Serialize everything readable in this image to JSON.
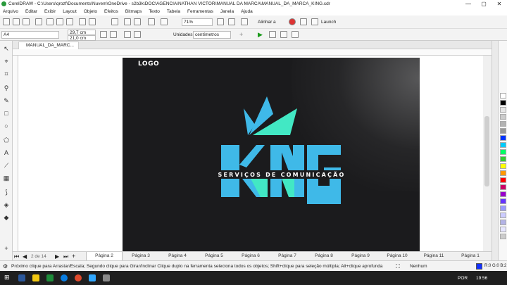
{
  "window": {
    "title": "CorelDRAW - C:\\Users\\qrozf\\Documents\\Nuvem\\OneDrive - s2b3k\\DOC\\AGENCIA\\NATHAN VICTOR\\MANUAL DA MARCA\\MANUAL_DA_MARCA_KING.cdr",
    "minimize": "—",
    "maximize": "▢",
    "close": "✕"
  },
  "menu": [
    "Arquivo",
    "Editar",
    "Exibir",
    "Layout",
    "Objeto",
    "Efeitos",
    "Bitmaps",
    "Texto",
    "Tabela",
    "Ferramentas",
    "Janela",
    "Ajuda"
  ],
  "toolbar1": {
    "zoom": "71%",
    "align_label": "Alinhar a",
    "launch_label": "Launch"
  },
  "toolbar2": {
    "page_size": "A4",
    "width": "29,7 cm",
    "height": "21,0 cm",
    "units_label": "Unidades:",
    "units_value": "centímetros"
  },
  "document": {
    "tab_label": "MANUAL_DA_MARC..."
  },
  "artboard": {
    "logo_label": "LOGO",
    "brand_text": "KING",
    "tagline": "SERVIÇOS DE COMUNICAÇÃO"
  },
  "colors": {
    "brand_blue": "#3fb9e8",
    "brand_teal": "#42e8c4",
    "artboard_bg": "#1b1b1d"
  },
  "pagebar": {
    "counter": "2   de  14",
    "pages": [
      "Página 2",
      "Página 3",
      "Página 4",
      "Página 5",
      "Página 6",
      "Página 7",
      "Página 8",
      "Página 9",
      "Página 10",
      "Página 11",
      "Página 1"
    ],
    "active_index": 0
  },
  "status": {
    "hint": "Próximo clique para Arrastar/Escala; Segundo clique para Girar/Inclinar Clique duplo na ferramenta seleciona todos os objetos; Shift+clique para seleção múltipla; Alt+clique aprofunda",
    "fill_label": "Nenhum",
    "color_readout": "R:0 G:0 B:2"
  },
  "taskbar": {
    "language": "POR",
    "time": "19:56"
  },
  "palette": [
    "#ffffff",
    "#000000",
    "#e6e6e6",
    "#cccccc",
    "#b3b3b3",
    "#999999",
    "#0033ff",
    "#00ccff",
    "#00ff66",
    "#33cc33",
    "#ffff00",
    "#ff9900",
    "#ff0000",
    "#cc0066",
    "#9900cc",
    "#6633ff",
    "#9999ff",
    "#ccccff",
    "#b3b3e6",
    "#e6e6ff",
    "#cccccc"
  ]
}
